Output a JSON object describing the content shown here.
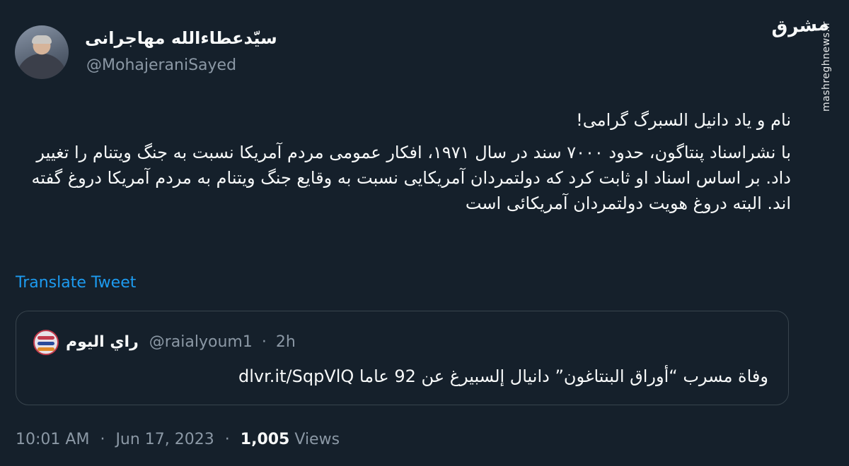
{
  "author": {
    "name": "سیّدعطاءالله مهاجرانی",
    "handle": "@MohajeraniSayed"
  },
  "watermark": {
    "logo_text": "مشرق",
    "site": "mashreghnews.ir"
  },
  "tweet": {
    "lines": [
      "نام و یاد دانیل السبرگ گرامی!",
      "با نشراسناد پنتاگون، حدود ۷۰۰۰ سند در سال ۱۹۷۱، افکار عمومی مردم آمریکا نسبت به جنگ ویتنام را تغییر داد. بر اساس اسناد او ثابت کرد که دولتمردان آمریکایی نسبت به وقایع جنگ ویتنام به مردم آمریکا دروغ گفته اند. البته دروغ هویت دولتمردان آمریکائی است"
    ],
    "translate_label": "Translate Tweet"
  },
  "quoted": {
    "name": "راي اليوم",
    "handle": "@raialyoum1",
    "separator": "·",
    "time": "2h",
    "text": "وفاة مسرب “أوراق البنتاغون” دانيال إلسبيرغ عن 92 عاما dlvr.it/SqpVlQ"
  },
  "meta": {
    "time": "10:01 AM",
    "date": "Jun 17, 2023",
    "separator": "·",
    "views_count": "1,005",
    "views_label": "Views"
  },
  "colors": {
    "background": "#15202b",
    "link": "#1d9bf0",
    "secondary_text": "#8b98a5",
    "border": "#38444d"
  }
}
